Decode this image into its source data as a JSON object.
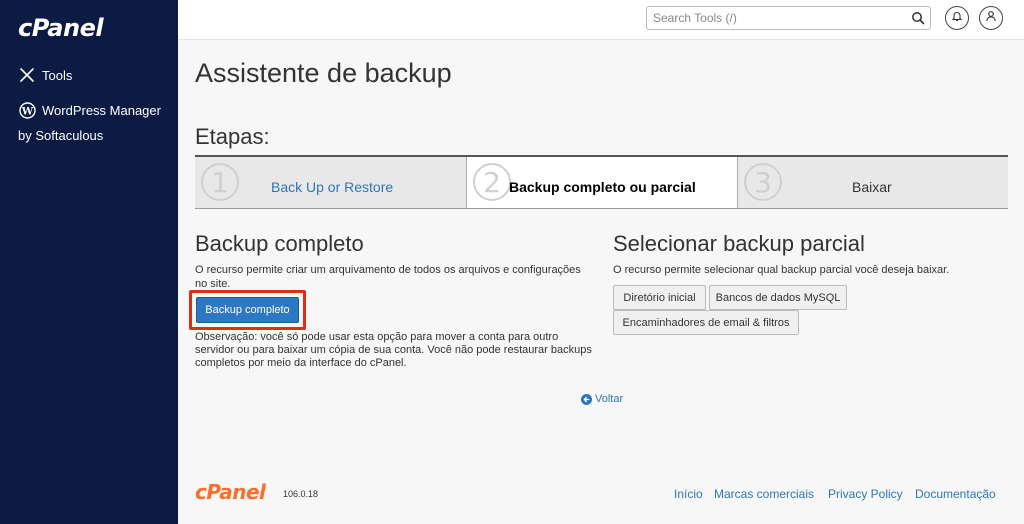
{
  "sidebar": {
    "logo": "cPanel",
    "items": [
      {
        "label": "Tools"
      },
      {
        "label": "WordPress Manager",
        "label2": "by Softaculous"
      }
    ]
  },
  "topbar": {
    "search_placeholder": "Search Tools (/)"
  },
  "page": {
    "title": "Assistente de backup",
    "steps_heading": "Etapas:",
    "steps": [
      {
        "num": "1",
        "label": "Back Up or Restore"
      },
      {
        "num": "2",
        "label": "Backup completo ou parcial"
      },
      {
        "num": "3",
        "label": "Baixar"
      }
    ],
    "full": {
      "heading": "Backup completo",
      "description": "O recurso permite criar um arquivamento de todos os arquivos e configurações no site.",
      "button": "Backup completo",
      "note": "Observação: você só pode usar esta opção para mover a conta para outro servidor ou para baixar um cópia de sua conta. Você não pode restaurar backups completos por meio da interface do cPanel."
    },
    "partial": {
      "heading": "Selecionar backup parcial",
      "description": "O recurso permite selecionar qual backup parcial você deseja baixar.",
      "buttons": [
        "Diretório inicial",
        "Bancos de dados MySQL",
        "Encaminhadores de email & filtros"
      ]
    },
    "back_link": "Voltar"
  },
  "footer": {
    "logo": "cPanel",
    "version": "106.0.18",
    "links": [
      "Início",
      "Marcas comerciais",
      "Privacy Policy",
      "Documentação"
    ]
  },
  "colors": {
    "sidebar_bg": "#0c1b44",
    "accent_blue": "#2d78c4",
    "link_blue": "#2d76b9",
    "highlight_red": "#e32a1b",
    "brand_orange": "#ff6c2c"
  }
}
